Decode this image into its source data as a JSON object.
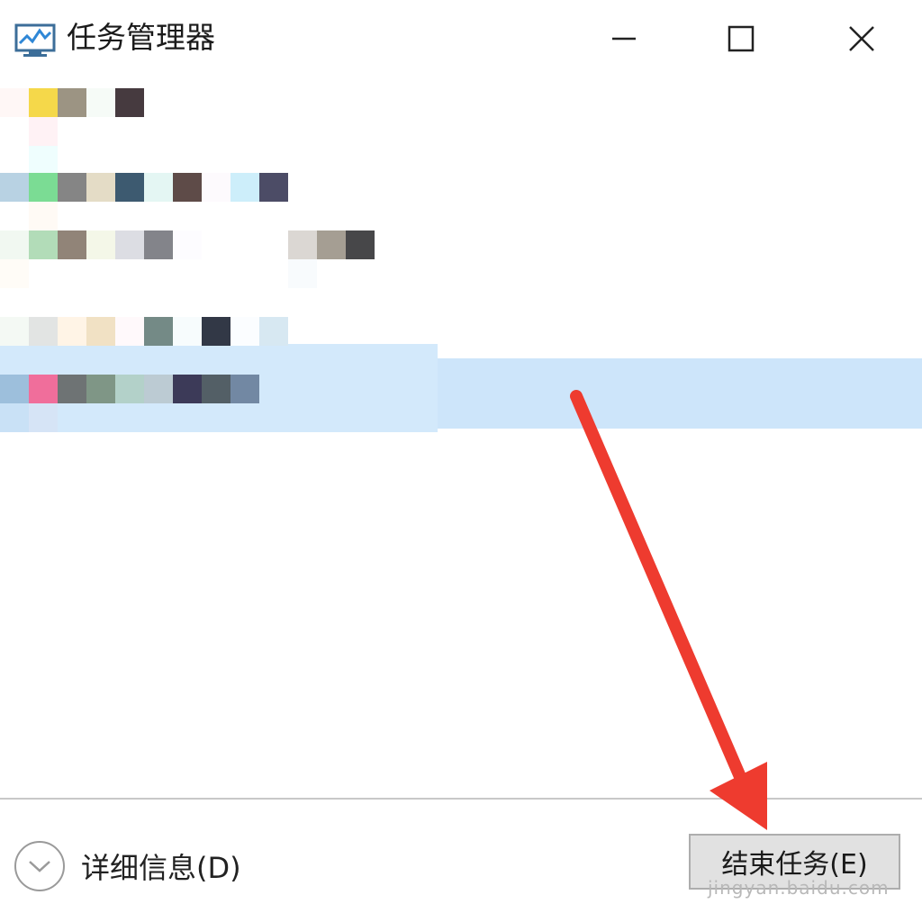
{
  "window": {
    "title": "任务管理器",
    "icon": "task-manager-icon"
  },
  "controls": {
    "minimize_icon": "minimize-icon",
    "maximize_icon": "maximize-icon",
    "close_icon": "close-icon"
  },
  "footer": {
    "details_label": "详细信息(D)",
    "details_icon": "chevron-down-icon",
    "end_task_label": "结束任务(E)",
    "watermark": "jingyan.baidu.com"
  },
  "colors": {
    "selection": "#cce5fb",
    "annotation_arrow": "#ee3b2f",
    "button_face": "#e1e1e1"
  },
  "process_rows": [
    {
      "selected": false
    },
    {
      "selected": false
    },
    {
      "selected": false
    },
    {
      "selected": false
    },
    {
      "selected": false
    },
    {
      "selected": true
    }
  ]
}
